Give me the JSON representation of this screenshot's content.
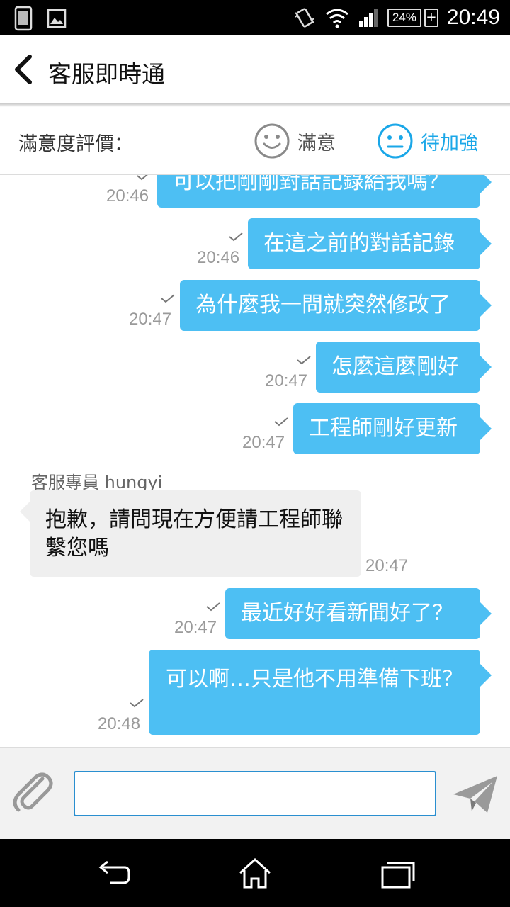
{
  "status_bar": {
    "time": "20:49",
    "battery": "24%",
    "battery_charging": "+",
    "icons": [
      "phone-screen-icon",
      "image-icon",
      "vibrate-icon",
      "wifi-icon",
      "signal-icon",
      "battery-icon"
    ]
  },
  "header": {
    "title": "客服即時通",
    "back_icon": "chevron-left-icon"
  },
  "rating": {
    "label": "滿意度評價：",
    "options": [
      {
        "label": "滿意",
        "icon": "smile-face-icon",
        "selected": false
      },
      {
        "label": "待加強",
        "icon": "neutral-face-icon",
        "selected": true
      }
    ],
    "accent": "#1aa7e8"
  },
  "messages": [
    {
      "from": "user",
      "text": "可以把剛剛對話記錄給我嗎？",
      "time": "20:46",
      "read": true
    },
    {
      "from": "user",
      "text": "在這之前的對話記錄",
      "time": "20:46",
      "read": true
    },
    {
      "from": "user",
      "text": "為什麼我一問就突然修改了",
      "time": "20:47",
      "read": true
    },
    {
      "from": "user",
      "text": "怎麼這麼剛好",
      "time": "20:47",
      "read": true
    },
    {
      "from": "user",
      "text": "工程師剛好更新",
      "time": "20:47",
      "read": true
    },
    {
      "from": "agent",
      "sender": "客服專員 hungyi",
      "text": "抱歉，請問現在方便請工程師聯繫您嗎",
      "time": "20:47"
    },
    {
      "from": "user",
      "text": "最近好好看新聞好了？",
      "time": "20:47",
      "read": true
    },
    {
      "from": "user",
      "text": "可以啊…只是他不用準備下班？",
      "time": "20:48",
      "read": true
    }
  ],
  "colors": {
    "user_bubble": "#4dbff3",
    "agent_bubble": "#efefef",
    "time_text": "#9a9a9a"
  },
  "input": {
    "value": "",
    "placeholder": "",
    "attach_icon": "paperclip-icon",
    "send_icon": "send-plane-icon"
  },
  "nav": {
    "icons": [
      "back-arrow-icon",
      "home-icon",
      "recent-apps-icon"
    ]
  }
}
